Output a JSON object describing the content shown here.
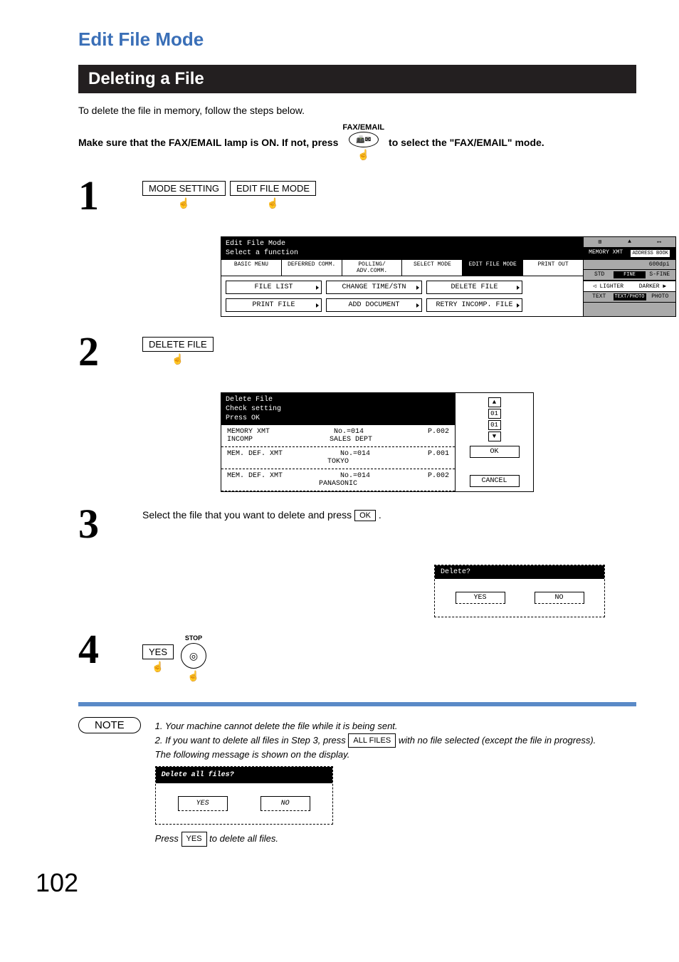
{
  "title": "Edit File Mode",
  "subtitle": "Deleting a File",
  "intro": "To delete the file in memory, follow the steps below.",
  "prereq": {
    "part1": "Make sure that the FAX/EMAIL lamp is ON.  If not, press",
    "icon_label": "FAX/EMAIL",
    "part2": "to select the \"FAX/EMAIL\" mode."
  },
  "steps": {
    "s1": {
      "num": "1",
      "btn1": "MODE SETTING",
      "btn2": "EDIT FILE MODE"
    },
    "s2": {
      "num": "2",
      "btn": "DELETE FILE"
    },
    "s3": {
      "num": "3",
      "text_a": "Select the file that you want to delete and press ",
      "ok": "OK",
      "text_b": "."
    },
    "s4": {
      "num": "4",
      "btn": "YES",
      "stop": "STOP"
    }
  },
  "screen1": {
    "hdr1": "Edit File Mode",
    "hdr2": "Select a function",
    "tabs": [
      "BASIC MENU",
      "DEFERRED COMM.",
      "POLLING/ ADV.COMM.",
      "SELECT MODE",
      "EDIT FILE MODE",
      "PRINT OUT"
    ],
    "opts": [
      "FILE LIST",
      "CHANGE TIME/STN",
      "DELETE FILE",
      "PRINT FILE",
      "ADD DOCUMENT",
      "RETRY INCOMP. FILE"
    ],
    "side": {
      "memory": "MEMORY XMT",
      "addr": "ADDRESS BOOK",
      "dpi": "600dpi",
      "res": [
        "STD",
        "FINE",
        "S-FINE"
      ],
      "dark": [
        "LIGHTER",
        "DARKER"
      ],
      "mode": [
        "TEXT",
        "TEXT/PHOTO",
        "PHOTO"
      ]
    }
  },
  "screen2": {
    "hdr1": "Delete File",
    "hdr2": "Check setting",
    "hdr3": "Press OK",
    "rows": [
      {
        "c1": "MEMORY XMT",
        "c2": "No.=014",
        "c3": "P.002",
        "sub1": "INCOMP",
        "sub2": "SALES DEPT"
      },
      {
        "c1": "MEM. DEF. XMT",
        "c2": "No.=014",
        "c3": "P.001",
        "sub1": "",
        "sub2": "TOKYO"
      },
      {
        "c1": "MEM. DEF. XMT",
        "c2": "No.=014",
        "c3": "P.002",
        "sub1": "",
        "sub2": "PANASONIC"
      }
    ],
    "ok": "OK",
    "cancel": "CANCEL",
    "up": "01",
    "dn": "01"
  },
  "screen3": {
    "hdr": "Delete?",
    "yes": "YES",
    "no": "NO"
  },
  "notes": {
    "label": "NOTE",
    "n1": "1. Your machine cannot delete the file while it is being sent.",
    "n2a": "2. If you want to delete all files in Step 3, press ",
    "allfiles": "ALL FILES",
    "n2b": " with no file selected (except the file in progress).",
    "n2c": "The following message is shown on the display.",
    "press_a": "Press ",
    "yes": "YES",
    "press_b": " to delete all files."
  },
  "screen4": {
    "hdr": "Delete all files?",
    "yes": "YES",
    "no": "NO"
  },
  "pagenum": "102"
}
